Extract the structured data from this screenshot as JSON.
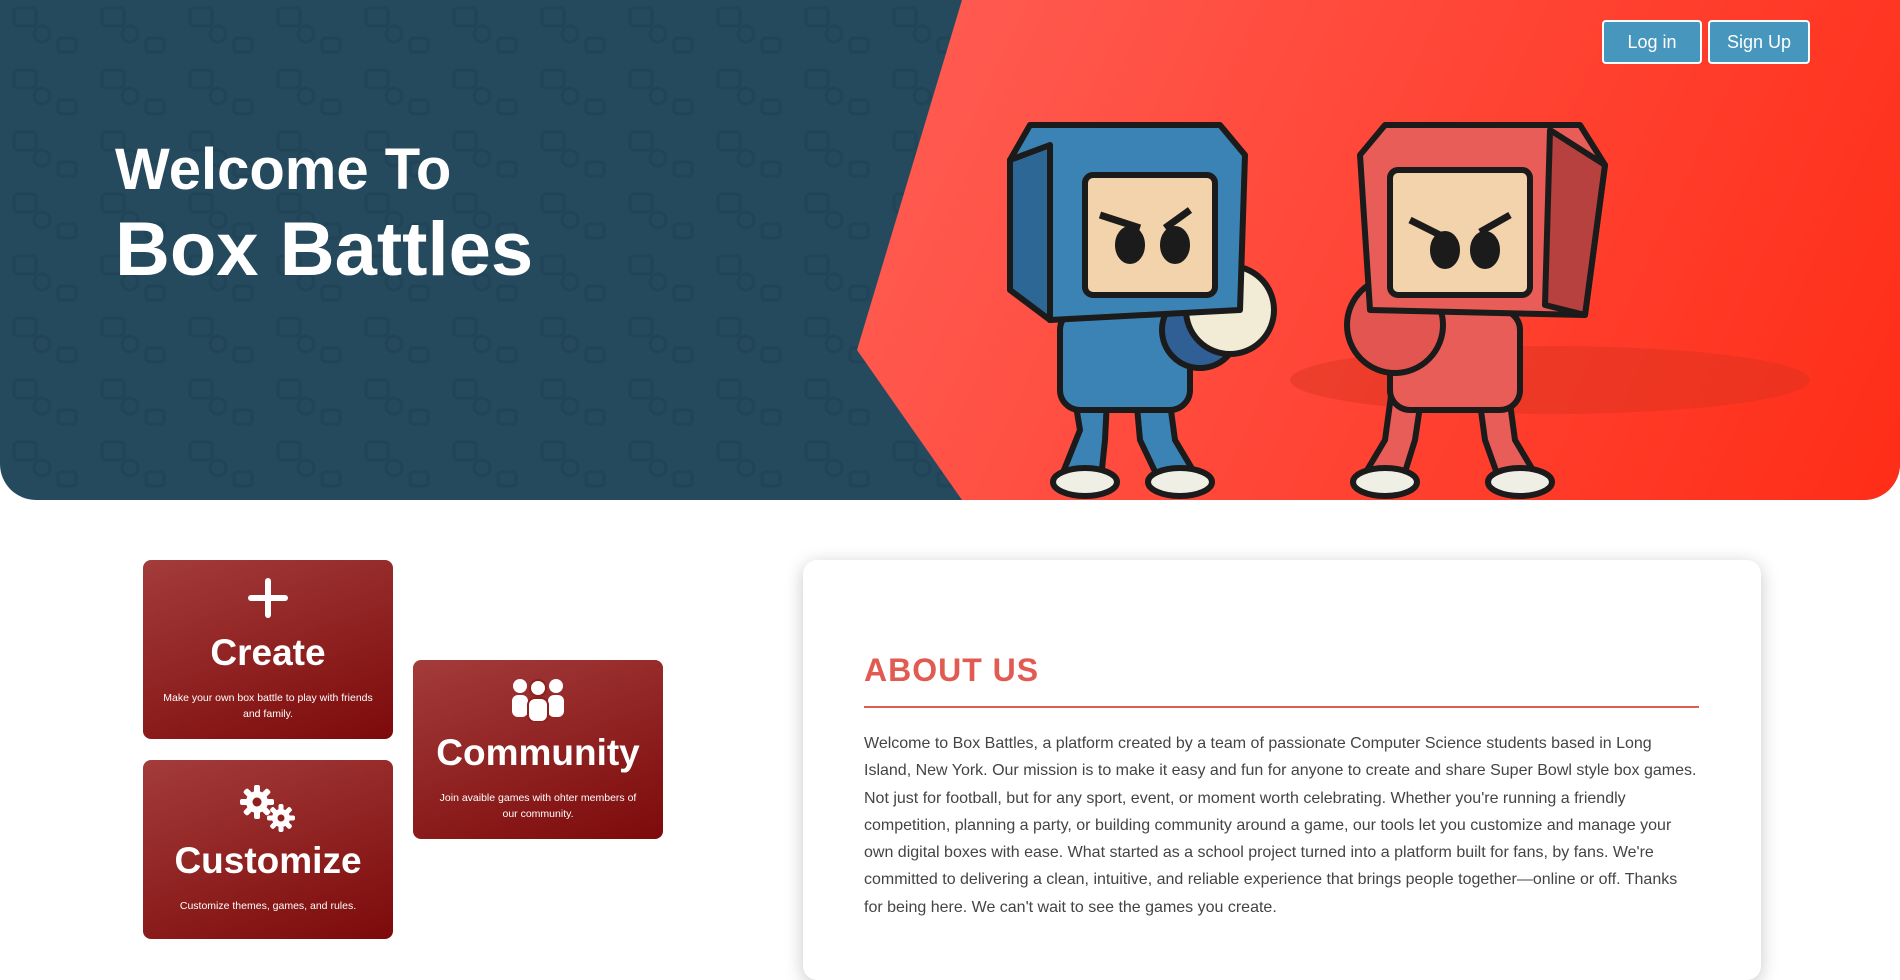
{
  "hero": {
    "title_line1": "Welcome To",
    "title_line2": "Box Battles",
    "left_color": "#254a5e",
    "right_color": "#ff4a3c"
  },
  "auth": {
    "login_label": "Log in",
    "signup_label": "Sign Up"
  },
  "cards": {
    "create": {
      "icon": "plus-icon",
      "title": "Create",
      "desc": "Make your own box battle to play with friends and family."
    },
    "community": {
      "icon": "people-icon",
      "title": "Community",
      "desc": "Join avaible games with ohter members of our community."
    },
    "customize": {
      "icon": "gears-icon",
      "title": "Customize",
      "desc": "Customize themes, games, and rules."
    }
  },
  "about": {
    "title": "ABOUT US",
    "body": "Welcome to Box Battles, a platform created by a team of passionate Computer Science students based in Long Island, New York. Our mission is to make it easy and fun for anyone to create and share Super Bowl style box games. Not just for football, but for any sport, event, or moment worth celebrating. Whether you're running a friendly competition, planning a party, or building community around a game, our tools let you customize and manage your own digital boxes with ease. What started as a school project turned into a platform built for fans, by fans. We're committed to delivering a clean, intuitive, and reliable experience that brings people together—online or off. Thanks for being here. We can't wait to see the games you create.",
    "accent_color": "#e25b52"
  }
}
